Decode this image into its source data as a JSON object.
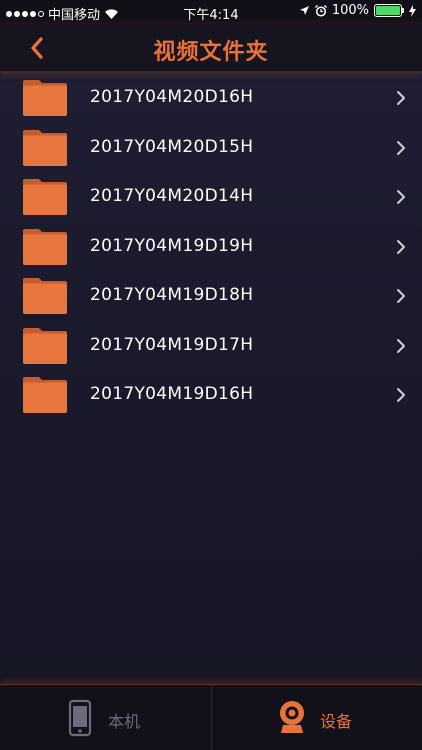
{
  "status_bar": {
    "carrier": "中国移动",
    "time": "下午4:14",
    "battery_text": "100%"
  },
  "nav": {
    "title": "视频文件夹",
    "back_icon": "chevron-left-icon"
  },
  "folders": [
    {
      "name": "2017Y04M20D16H"
    },
    {
      "name": "2017Y04M20D15H"
    },
    {
      "name": "2017Y04M20D14H"
    },
    {
      "name": "2017Y04M19D19H"
    },
    {
      "name": "2017Y04M19D18H"
    },
    {
      "name": "2017Y04M19D17H"
    },
    {
      "name": "2017Y04M19D16H"
    }
  ],
  "tabs": {
    "local_label": "本机",
    "device_label": "设备"
  },
  "colors": {
    "accent": "#e8723a",
    "background": "#1b1a2c",
    "inactive": "#6c6a7c"
  }
}
